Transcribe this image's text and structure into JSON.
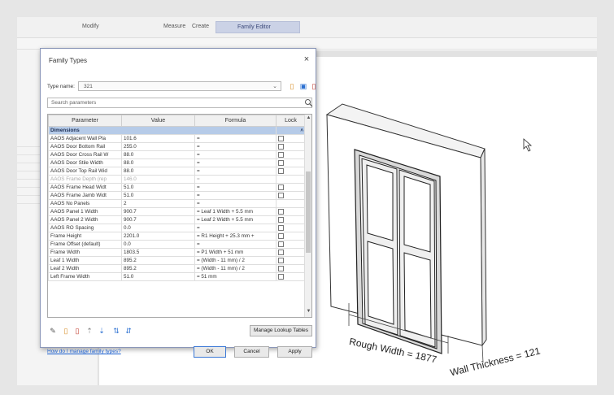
{
  "ribbon": {
    "tabs": [
      "Modify",
      "Measure",
      "Create"
    ],
    "active_tab": "Family Editor"
  },
  "left_panel_rows": [
    "",
    "",
    "",
    "",
    "",
    "",
    "",
    ""
  ],
  "dialog": {
    "title": "Family Types",
    "close_glyph": "×",
    "type_name_label": "Type name:",
    "type_name_value": "321",
    "search_placeholder": "Search parameters",
    "columns": [
      "Parameter",
      "Value",
      "Formula",
      "Lock"
    ],
    "group_label": "Dimensions",
    "rows": [
      {
        "p": "AAOS Adjacent Wall Pla",
        "v": "101.6",
        "f": "=",
        "lock": true
      },
      {
        "p": "AAOS Door Bottom Rail",
        "v": "255.0",
        "f": "=",
        "lock": true
      },
      {
        "p": "AAOS Door Cross Rail W",
        "v": "88.0",
        "f": "=",
        "lock": true
      },
      {
        "p": "AAOS Door Stile Width",
        "v": "88.0",
        "f": "=",
        "lock": true
      },
      {
        "p": "AAOS Door Top Rail Wid",
        "v": "88.0",
        "f": "=",
        "lock": true
      },
      {
        "p": "AAOS Frame Depth (rep",
        "v": "146.0",
        "f": "=",
        "lock": false
      },
      {
        "p": "AAOS Frame Head Widt",
        "v": "51.0",
        "f": "=",
        "lock": true
      },
      {
        "p": "AAOS Frame Jamb Widt",
        "v": "51.0",
        "f": "=",
        "lock": true
      },
      {
        "p": "AAOS No Panels",
        "v": "2",
        "f": "=",
        "lock": false
      },
      {
        "p": "AAOS Panel 1 Width",
        "v": "900.7",
        "f": "= Leaf 1 Width + 5.5 mm",
        "lock": true
      },
      {
        "p": "AAOS Panel 2 Width",
        "v": "900.7",
        "f": "= Leaf 2 Width + 5.5 mm",
        "lock": true
      },
      {
        "p": "AAOS RO Spacing",
        "v": "0.0",
        "f": "=",
        "lock": true
      },
      {
        "p": "Frame Height",
        "v": "2201.0",
        "f": "= R1 Height + 25.3 mm +",
        "lock": true
      },
      {
        "p": "Frame Offset (default)",
        "v": "0.0",
        "f": "=",
        "lock": true
      },
      {
        "p": "Frame Width",
        "v": "1803.5",
        "f": "= P1 Width + 51 mm",
        "lock": true
      },
      {
        "p": "Leaf 1 Width",
        "v": "895.2",
        "f": "= (Width - 11 mm) / 2",
        "lock": true
      },
      {
        "p": "Leaf 2 Width",
        "v": "895.2",
        "f": "= (Width - 11 mm) / 2",
        "lock": true
      },
      {
        "p": "Left Frame Width",
        "v": "51.0",
        "f": "= 51 mm",
        "lock": true
      }
    ],
    "manage_lookup_label": "Manage Lookup Tables",
    "help_link": "How do I manage family types?",
    "ok_label": "OK",
    "cancel_label": "Cancel",
    "apply_label": "Apply"
  },
  "canvas": {
    "rough_width_label": "Rough Width = 1877",
    "wall_thickness_label": "Wall Thickness = 121"
  }
}
